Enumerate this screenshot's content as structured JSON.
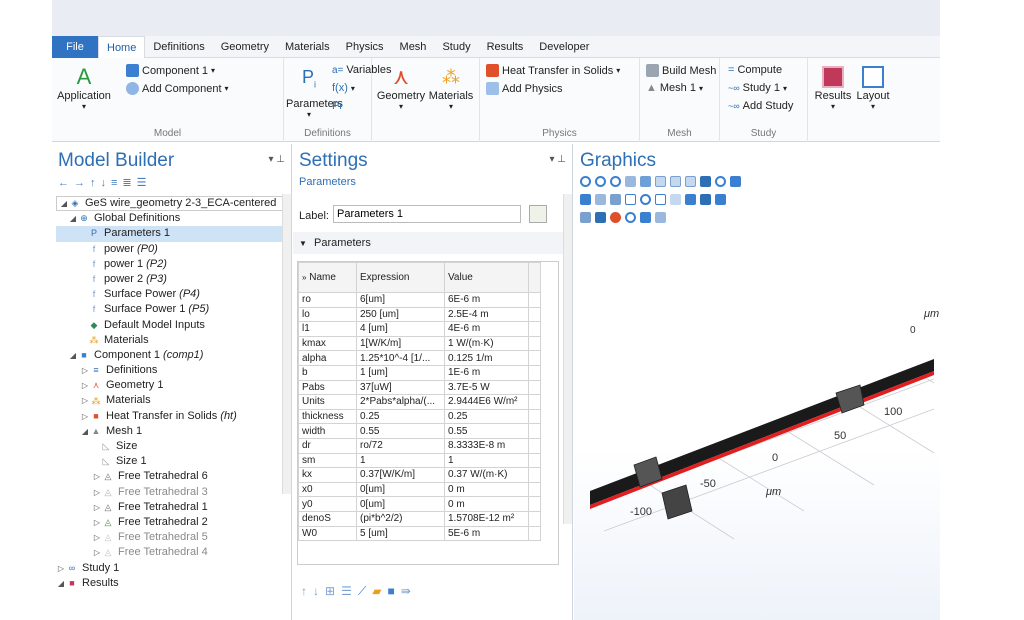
{
  "tabs": [
    "File",
    "Home",
    "Definitions",
    "Geometry",
    "Materials",
    "Physics",
    "Mesh",
    "Study",
    "Results",
    "Developer"
  ],
  "ribbon": {
    "application": "Application",
    "model_label": "Model",
    "component": "Component 1",
    "add_component": "Add Component",
    "parameters": "Parameters",
    "variables": "Variables",
    "functions": "f(x)",
    "pi": "Pi",
    "definitions_label": "Definitions",
    "geometry": "Geometry",
    "materials": "Materials",
    "heat_transfer": "Heat Transfer in Solids",
    "add_physics": "Add Physics",
    "physics_label": "Physics",
    "build_mesh": "Build Mesh",
    "mesh1": "Mesh 1",
    "mesh_label": "Mesh",
    "compute": "Compute",
    "study1": "Study 1",
    "add_study": "Add Study",
    "study_label": "Study",
    "results": "Results",
    "layout": "Layout"
  },
  "model_builder": {
    "title": "Model Builder",
    "tree": [
      {
        "label": "GeS wire_geometry 2-3_ECA-centered",
        "tag": ""
      },
      {
        "label": "Global Definitions",
        "tag": ""
      },
      {
        "label": "Parameters 1",
        "tag": ""
      },
      {
        "label": "power",
        "tag": "(P0)"
      },
      {
        "label": "power 1",
        "tag": "(P2)"
      },
      {
        "label": "power 2",
        "tag": "(P3)"
      },
      {
        "label": "Surface Power",
        "tag": "(P4)"
      },
      {
        "label": "Surface Power 1",
        "tag": "(P5)"
      },
      {
        "label": "Default Model Inputs",
        "tag": ""
      },
      {
        "label": "Materials",
        "tag": ""
      },
      {
        "label": "Component 1",
        "tag": "(comp1)"
      },
      {
        "label": "Definitions",
        "tag": ""
      },
      {
        "label": "Geometry 1",
        "tag": ""
      },
      {
        "label": "Materials",
        "tag": ""
      },
      {
        "label": "Heat Transfer in Solids",
        "tag": "(ht)"
      },
      {
        "label": "Mesh 1",
        "tag": ""
      },
      {
        "label": "Size",
        "tag": ""
      },
      {
        "label": "Size 1",
        "tag": ""
      },
      {
        "label": "Free Tetrahedral 6",
        "tag": ""
      },
      {
        "label": "Free Tetrahedral 3",
        "tag": ""
      },
      {
        "label": "Free Tetrahedral 1",
        "tag": ""
      },
      {
        "label": "Free Tetrahedral 2",
        "tag": ""
      },
      {
        "label": "Free Tetrahedral 5",
        "tag": ""
      },
      {
        "label": "Free Tetrahedral 4",
        "tag": ""
      },
      {
        "label": "Study 1",
        "tag": ""
      },
      {
        "label": "Results",
        "tag": ""
      }
    ]
  },
  "settings": {
    "title": "Settings",
    "subtitle": "Parameters",
    "label_caption": "Label:",
    "label_value": "Parameters 1",
    "section": "Parameters",
    "headers": [
      "Name",
      "Expression",
      "Value"
    ],
    "rows": [
      [
        "ro",
        "6[um]",
        "6E-6 m"
      ],
      [
        "lo",
        "250 [um]",
        "2.5E-4 m"
      ],
      [
        "l1",
        "4 [um]",
        "4E-6 m"
      ],
      [
        "kmax",
        "1[W/K/m]",
        "1 W/(m·K)"
      ],
      [
        "alpha",
        "1.25*10^-4 [1/...",
        "0.125 1/m"
      ],
      [
        "b",
        "1 [um]",
        "1E-6 m"
      ],
      [
        "Pabs",
        "37[uW]",
        "3.7E-5 W"
      ],
      [
        "Units",
        "2*Pabs*alpha/(...",
        "2.9444E6 W/m²"
      ],
      [
        "thickness",
        "0.25",
        "0.25"
      ],
      [
        "width",
        "0.55",
        "0.55"
      ],
      [
        "dr",
        "ro/72",
        "8.3333E-8 m"
      ],
      [
        "sm",
        "1",
        "1"
      ],
      [
        "kx",
        "0.37[W/K/m]",
        "0.37 W/(m·K)"
      ],
      [
        "x0",
        "0[um]",
        "0 m"
      ],
      [
        "y0",
        "0[um]",
        "0 m"
      ],
      [
        "denoS",
        "(pi*b^2/2)",
        "1.5708E-12 m²"
      ],
      [
        "W0",
        "5 [um]",
        "5E-6 m"
      ]
    ]
  },
  "graphics": {
    "title": "Graphics",
    "axis_unit": "μm",
    "ticks": [
      "0",
      "100",
      "50",
      "0",
      "-50",
      "-100"
    ]
  },
  "colors": {
    "accent": "#2d6fb5",
    "file_tab": "#2f73c2",
    "selection": "#cfe3f7",
    "wire": "#1a1a1a",
    "heater": "#e02020"
  }
}
